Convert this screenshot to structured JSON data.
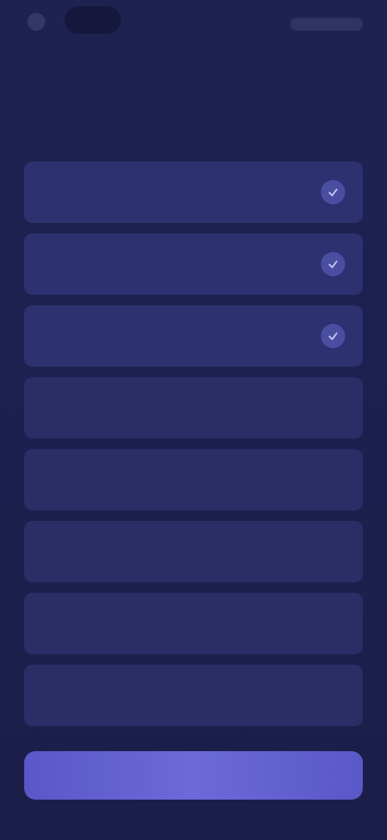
{
  "header": {
    "title_lines": [
      "",
      ""
    ]
  },
  "options": [
    {
      "label": "",
      "selected": true
    },
    {
      "label": "",
      "selected": true
    },
    {
      "label": "",
      "selected": true
    },
    {
      "label": "",
      "selected": false
    },
    {
      "label": "",
      "selected": false
    },
    {
      "label": "",
      "selected": false
    },
    {
      "label": "",
      "selected": false
    },
    {
      "label": "",
      "selected": false
    }
  ],
  "footer": {
    "continue_label": ""
  },
  "colors": {
    "background": "#1c2150",
    "option": "#2a2d66",
    "accent": "#6b6ad8"
  }
}
